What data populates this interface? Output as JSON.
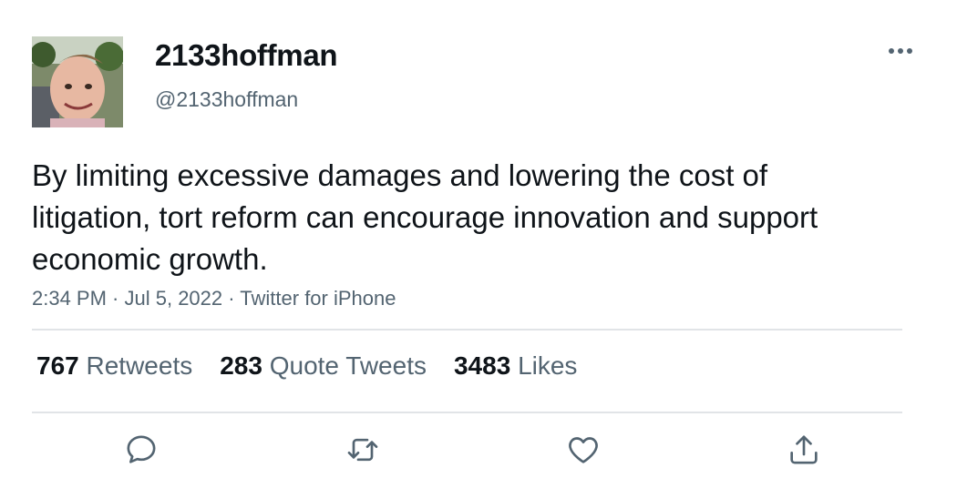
{
  "user": {
    "display_name": "2133hoffman",
    "handle": "@2133hoffman"
  },
  "menu": {
    "icon": "more-horizontal-icon"
  },
  "tweet": {
    "text": "By limiting excessive damages and lowering the cost of litigation, tort reform can encourage innovation and support economic growth.",
    "time": "2:34 PM",
    "date": "Jul 5, 2022",
    "source": "Twitter for iPhone",
    "sep": " · "
  },
  "stats": {
    "retweets_count": "767",
    "retweets_label": "Retweets",
    "quotes_count": "283",
    "quotes_label": "Quote Tweets",
    "likes_count": "3483",
    "likes_label": "Likes"
  },
  "actions": [
    {
      "name": "reply-icon"
    },
    {
      "name": "retweet-icon"
    },
    {
      "name": "like-icon"
    },
    {
      "name": "share-icon"
    }
  ],
  "colors": {
    "text": "#0f1419",
    "secondary": "#536471",
    "divider": "#e1e4e7"
  }
}
